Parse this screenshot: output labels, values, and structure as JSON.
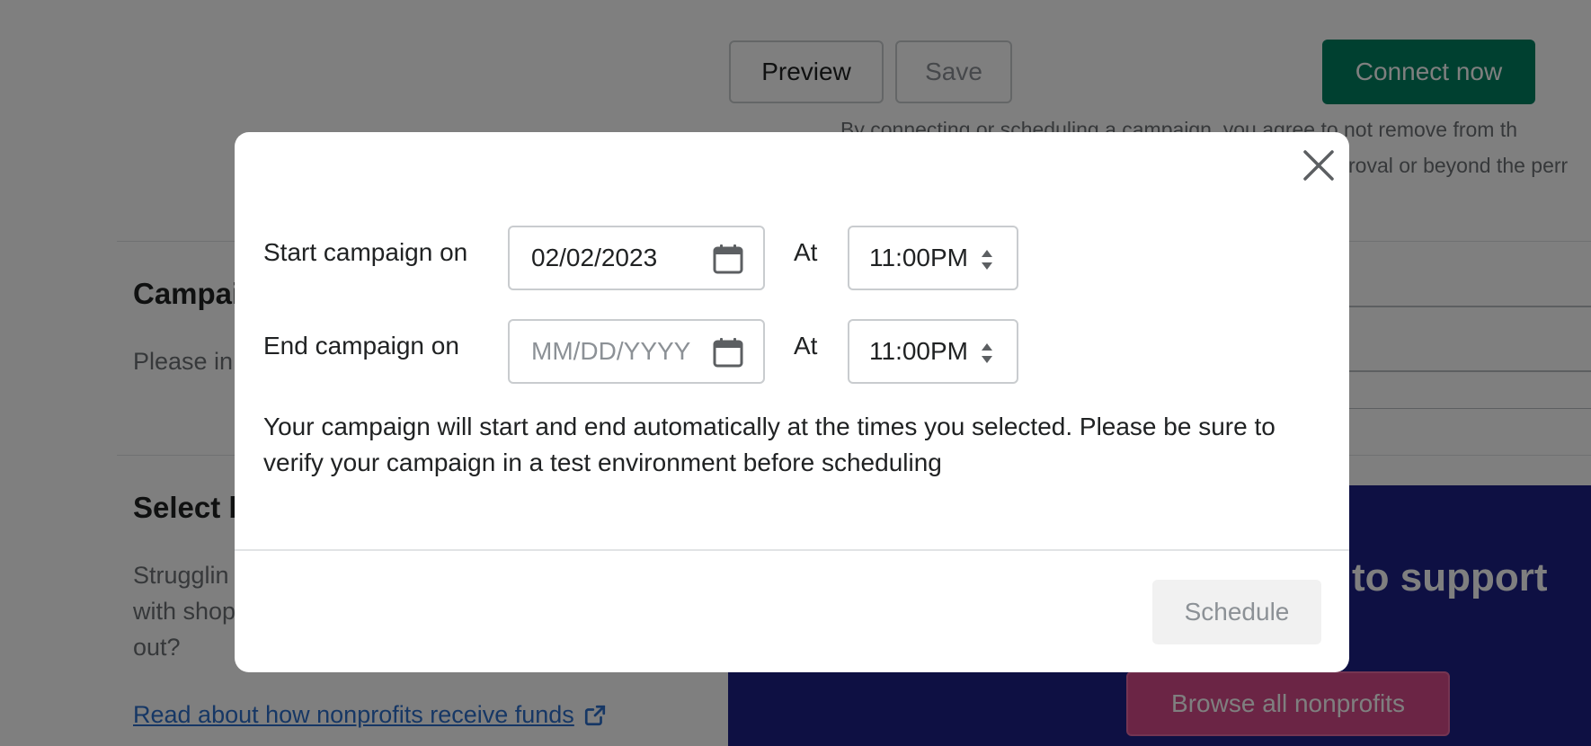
{
  "background": {
    "toolbar": {
      "preview_label": "Preview",
      "save_label": "Save",
      "connect_label": "Connect now"
    },
    "agreement": {
      "line1": "By connecting or scheduling a campaign, you agree to not remove from th",
      "line2": "roval or beyond the perr"
    },
    "campaign_section": {
      "heading": "Campai",
      "body": "Please in"
    },
    "select_section": {
      "heading": "Select b",
      "body_lines": [
        "Strugglin",
        "with shop",
        "out?"
      ]
    },
    "nonprofit_link": "Read about how nonprofits receive funds",
    "promo": {
      "heading": "to support",
      "button_label": "Browse all nonprofits",
      "color": "#1d2087"
    }
  },
  "modal": {
    "start": {
      "label": "Start campaign on",
      "date_value": "02/02/2023",
      "at_label": "At",
      "time_value": "11:00PM"
    },
    "end": {
      "label": "End campaign on",
      "date_placeholder": "MM/DD/YYYY",
      "at_label": "At",
      "time_value": "11:00PM"
    },
    "helper_text": "Your campaign will start and end automatically at the times you selected. Please be sure to verify your campaign in a test environment before scheduling",
    "schedule_label": "Schedule",
    "icons": {
      "close": "close-icon",
      "calendar": "calendar-icon",
      "stepper": "select-stepper-icon"
    }
  },
  "colors": {
    "primary_green": "#008060",
    "link_blue": "#2c6ecb",
    "overlay": "rgba(0,0,0,0.5)"
  }
}
